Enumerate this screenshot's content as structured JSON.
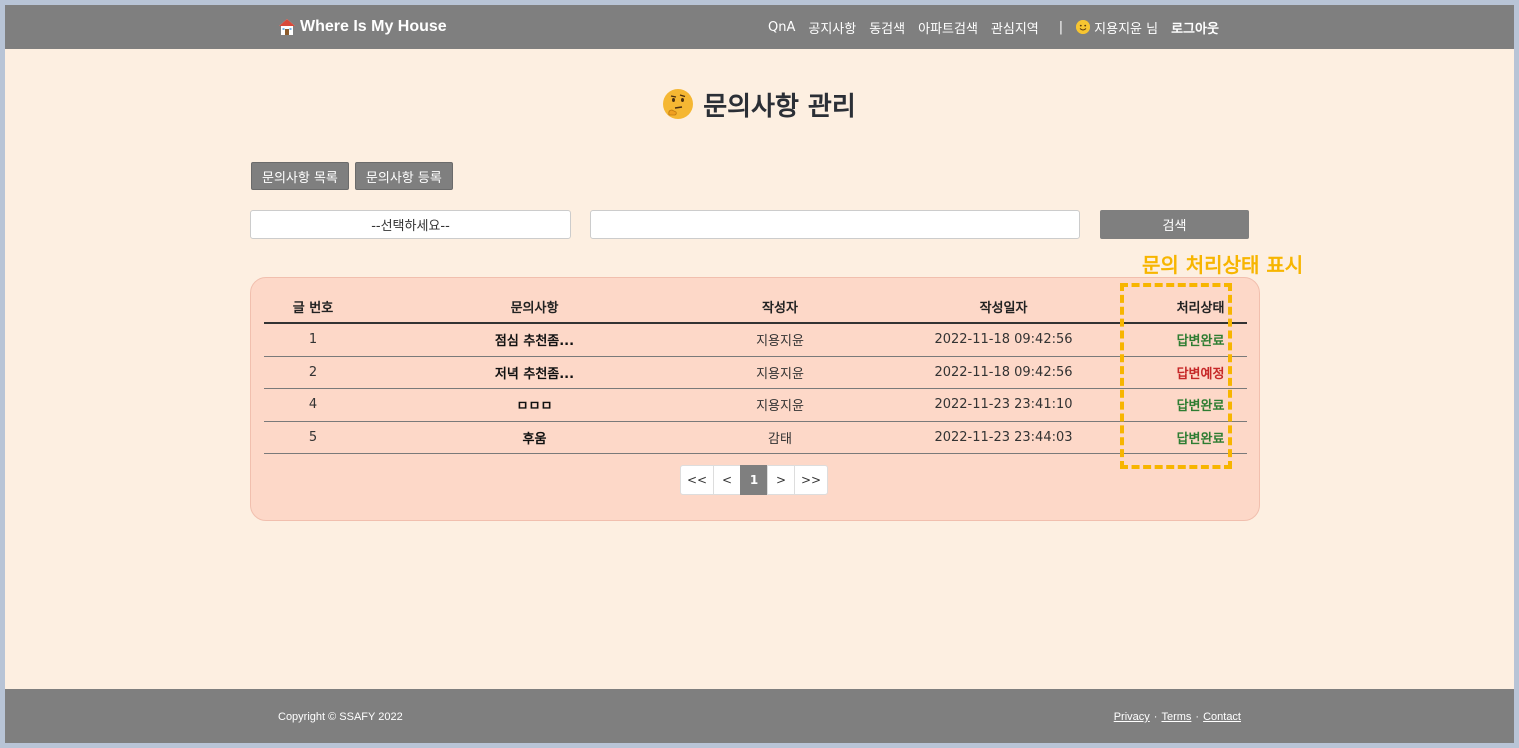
{
  "navbar": {
    "brand": "Where Is My House",
    "links": [
      "QnA",
      "공지사항",
      "동검색",
      "아파트검색",
      "관심지역"
    ],
    "separator": "|",
    "user": "지용지윤 님",
    "logout": "로그아웃"
  },
  "page": {
    "title": "문의사항 관리",
    "tabs": [
      "문의사항 목록",
      "문의사항 등록"
    ]
  },
  "search": {
    "select_value": "--선택하세요--",
    "input_value": "",
    "button": "검색"
  },
  "annotation": "문의 처리상태 표시",
  "table": {
    "headers": [
      "글 번호",
      "문의사항",
      "작성자",
      "작성일자",
      "처리상태"
    ],
    "rows": [
      {
        "no": "1",
        "title": "점심 추천좀...",
        "author": "지용지윤",
        "date": "2022-11-18 09:42:56",
        "status": "답변완료"
      },
      {
        "no": "2",
        "title": "저녁 추천좀...",
        "author": "지용지윤",
        "date": "2022-11-18 09:42:56",
        "status": "답변예정"
      },
      {
        "no": "4",
        "title": "ㅁㅁㅁ",
        "author": "지용지윤",
        "date": "2022-11-23 23:41:10",
        "status": "답변완료"
      },
      {
        "no": "5",
        "title": "후움",
        "author": "감태",
        "date": "2022-11-23 23:44:03",
        "status": "답변완료"
      }
    ]
  },
  "pagination": {
    "first": "<<",
    "prev": "<",
    "current": "1",
    "next": ">",
    "last": ">>"
  },
  "footer": {
    "copyright": "Copyright © SSAFY 2022",
    "privacy": "Privacy",
    "terms": "Terms",
    "contact": "Contact",
    "dot": "·"
  },
  "colors": {
    "navbar_bg": "#7f7f7f",
    "page_bg": "#fdefe1",
    "card_bg": "#fdd8c8",
    "accent": "#f7b500",
    "status_done": "#2e7d32",
    "status_pending": "#c62828"
  },
  "icons": {
    "brand": "house-icon",
    "user": "smile-icon",
    "title": "thinking-face-icon"
  }
}
